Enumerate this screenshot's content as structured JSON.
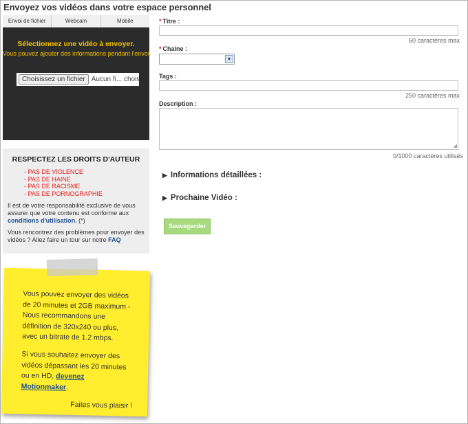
{
  "page": {
    "title": "Envoyez vos vidéos dans votre espace personnel"
  },
  "upload": {
    "tabs": [
      {
        "label": "Envoi de fichier"
      },
      {
        "label": "Webcam"
      },
      {
        "label": "Mobile"
      }
    ],
    "heading": "Sélectionnez une vidéo à envoyer.",
    "subheading": "Vous pouvez ajouter des informations pendant l'envoi.",
    "file_button": "Choisissez un fichier",
    "file_status": "Aucun fi... choisi"
  },
  "rights": {
    "title": "RESPECTEZ LES DROITS D'AUTEUR",
    "rules": [
      "- PAS DE VIOLENCE",
      "- PAS DE HAINE",
      "- PAS DE RACISME",
      "- PAS DE PORNOGRAPHIE"
    ],
    "responsibility": "Il est de votre responsabilité exclusive de vous assurer que votre contenu est conforme aux",
    "terms_link": "conditions d'utilisation.",
    "terms_suffix": " (*)",
    "problems": "Vous rencontrez des problèmes pour envoyer des vidéos ? Allez faire un tour sur notre",
    "faq_link": "FAQ"
  },
  "note": {
    "para1": "Vous pouvez envoyer des vidéos de 20 minutes et 2GB maximum - Nous recommandons une définition de 320x240 ou plus, avec un bitrate de 1.2 mbps.",
    "para2_prefix": "Si vous souhaitez envoyer des vidéos dépassant les 20 minutes ou en HD, ",
    "para2_link": "devenez Motionmaker",
    "para2_suffix": ".",
    "closing": "Faites vous plaisir !"
  },
  "form": {
    "required_mark": "*",
    "title_label": "Titre :",
    "title_value": "",
    "title_counter": "60 caractères max",
    "channel_label": "Chaîne :",
    "channel_value": "",
    "tags_label": "Tags :",
    "tags_value": "",
    "tags_counter": "250 caractères max",
    "description_label": "Description :",
    "description_value": "",
    "description_counter": "0/1000 caractères utilisés",
    "details_section": "Informations détaillées :",
    "next_section": "Prochaine Vidéo :",
    "section_arrow": "▶",
    "save_button": "Sauvegarder"
  }
}
